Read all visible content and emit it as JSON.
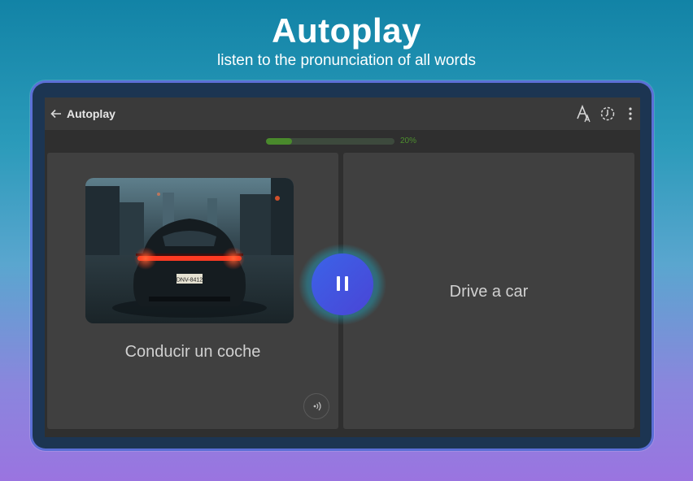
{
  "header": {
    "title": "Autoplay",
    "subtitle": "listen to the pronunciation of all words"
  },
  "appbar": {
    "title": "Autoplay",
    "icons": [
      "back-arrow-icon",
      "font-size-icon",
      "speed-icon",
      "more-vert-icon"
    ]
  },
  "progress": {
    "value_percent": 20,
    "label": "20%"
  },
  "card_front": {
    "word": "Conducir un coche",
    "image": "car-rear-city-rain-photo",
    "license_plate": "DNV-8412"
  },
  "card_back": {
    "word": "Drive a car"
  },
  "colors": {
    "accent": "#3f51e0",
    "progress": "#4a8a2c",
    "card": "#404040"
  }
}
